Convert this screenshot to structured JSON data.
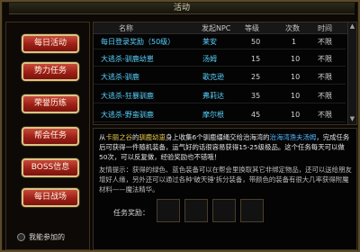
{
  "window": {
    "title": "活动"
  },
  "sidebar": {
    "items": [
      {
        "label": "每日活动"
      },
      {
        "label": "势力任务"
      },
      {
        "label": "荣誉历练"
      },
      {
        "label": "帮会任务"
      },
      {
        "label": "BOSS信息"
      },
      {
        "label": "每日战场"
      }
    ],
    "checkbox_label": "我能参加的"
  },
  "table": {
    "headers": [
      "名称",
      "发起NPC",
      "等级",
      "次数",
      "时间"
    ],
    "rows": [
      {
        "name": "每日登录奖励（50级）",
        "npc": "莱安",
        "level": "50",
        "count": "1",
        "time": "不限"
      },
      {
        "name": "大逃杀-驯鹿幼崽",
        "npc": "汤姆",
        "level": "15",
        "count": "10",
        "time": "不限"
      },
      {
        "name": "大逃杀-驯鹿",
        "npc": "歌克逊",
        "level": "25",
        "count": "10",
        "time": "不限"
      },
      {
        "name": "大逃杀-狂暴驯鹿",
        "npc": "弗莉达",
        "level": "35",
        "count": "10",
        "time": "不限"
      },
      {
        "name": "大逃杀-野蛮驯鹿",
        "npc": "摩尔根",
        "level": "45",
        "count": "10",
        "time": "不限"
      }
    ]
  },
  "description": {
    "p1_a": "从",
    "p1_npc": "卡丽之谷",
    "p1_b": "的",
    "p1_target": "驯鹿幼崽",
    "p1_c": "身上收集6个驯鹿缰绳交给治海湾的",
    "p1_npc2": "治海湾渔夫汤姆",
    "p1_d": "，完成任务后可获得一件随机装备，运气好的话很容易获得15-25级极品。这个任务每天可以做50次，可以反复做，经验奖励也不错哦！",
    "p2": "友情提示：获得的绿色、蓝色装备可以在帮会里换取其它非绑定物品，还可以送给朋友增好人缘，另外还可以通过各种'破天锤'拆分装备，带颜色的装备有很大几率获得附魔材料——魔法精华。",
    "reward_label": "任务奖励："
  }
}
